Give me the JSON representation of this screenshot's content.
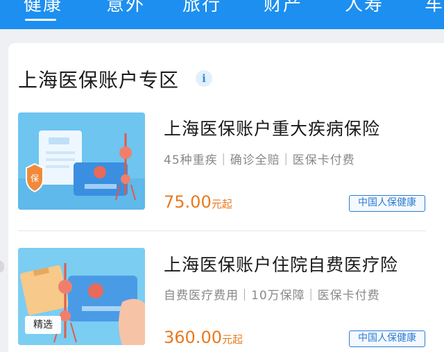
{
  "tabs": [
    {
      "label": "健康",
      "active": true
    },
    {
      "label": "意外"
    },
    {
      "label": "旅行"
    },
    {
      "label": "财产"
    },
    {
      "label": "人寿"
    },
    {
      "label": "车"
    }
  ],
  "section": {
    "title": "上海医保账户专区",
    "info_icon": "i"
  },
  "products": [
    {
      "title": "上海医保账户重大疾病保险",
      "tags": "45种重疾｜确诊全赔｜医保卡付费",
      "price": "75.00",
      "price_suffix": "元起",
      "brand": "中国人保健康",
      "image_badge": "保"
    },
    {
      "title": "上海医保账户住院自费医疗险",
      "tags": "自费医疗费用｜10万保障｜医保卡付费",
      "price": "360.00",
      "price_suffix": "元起",
      "brand": "中国人保健康",
      "image_badge": "精选"
    }
  ],
  "colors": {
    "tabbar": "#1d8ff0",
    "price": "#e87a1e",
    "brand_border": "#2c7bd0"
  }
}
